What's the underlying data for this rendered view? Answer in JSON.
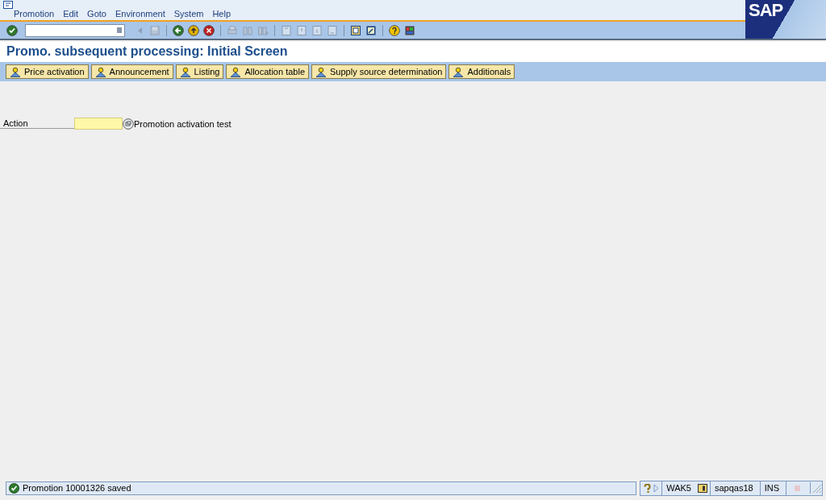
{
  "menu": [
    "Promotion",
    "Edit",
    "Goto",
    "Environment",
    "System",
    "Help"
  ],
  "logo": "SAP",
  "title": "Promo. subsequent processing: Initial Screen",
  "app_buttons": [
    "Price activation",
    "Announcement",
    "Listing",
    "Allocation table",
    "Supply source determination",
    "Additionals"
  ],
  "fields": [
    {
      "label": "Action",
      "description": "Promotion activation test"
    }
  ],
  "status_bar": {
    "message": "Promotion 10001326 saved",
    "system": "WAK5",
    "server": "sapqas18",
    "mode": "INS"
  }
}
